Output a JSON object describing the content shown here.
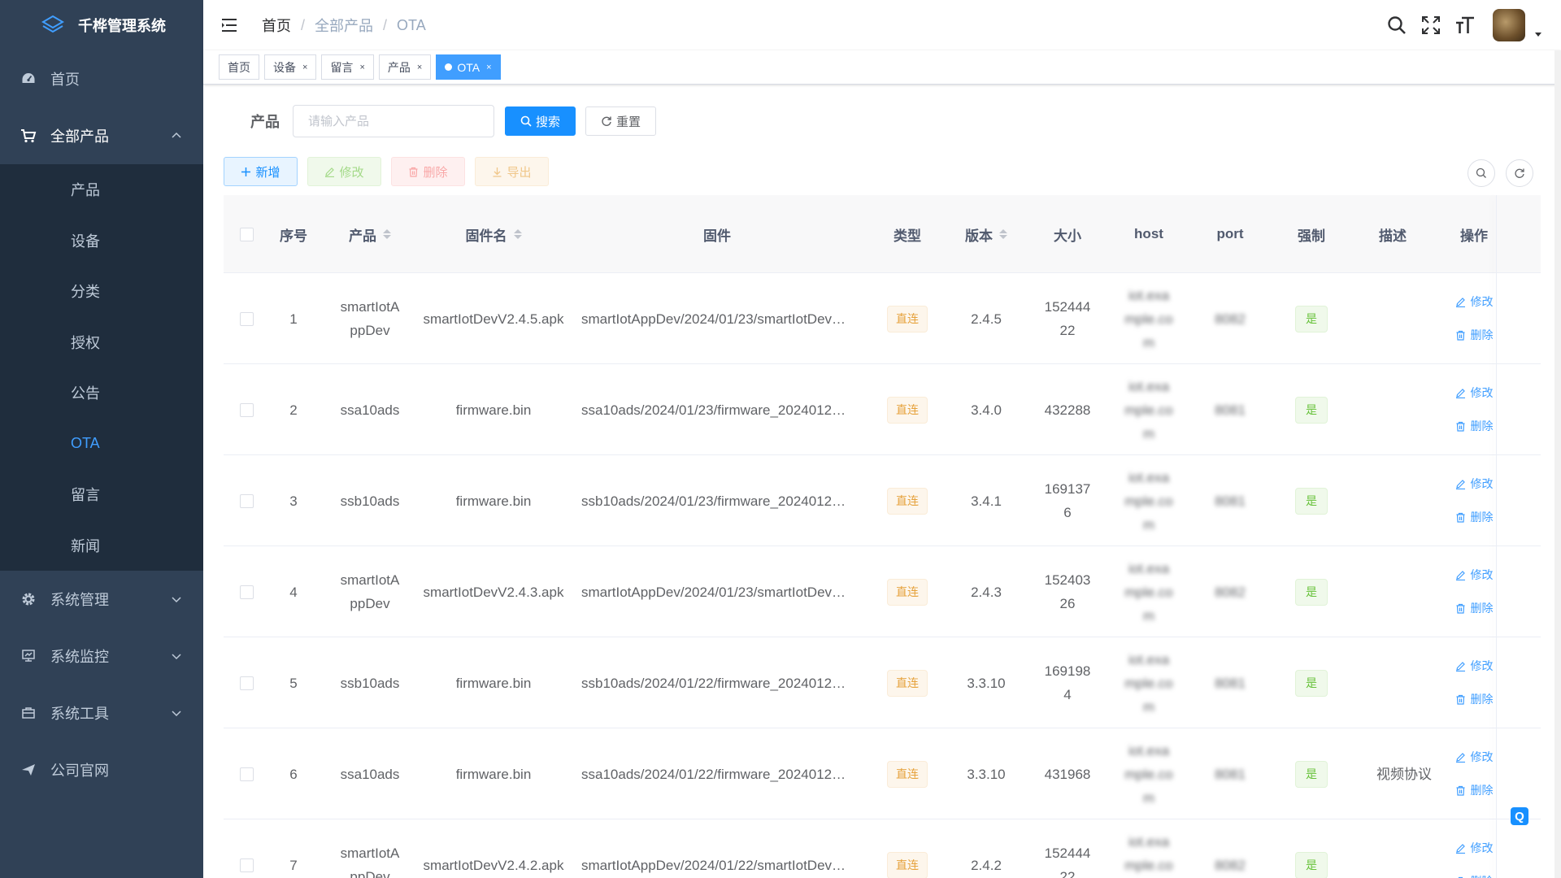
{
  "app": {
    "title": "千桦管理系统"
  },
  "sidebar": {
    "items": [
      {
        "label": "首页",
        "icon": "dashboard-icon"
      },
      {
        "label": "全部产品",
        "icon": "cart-icon",
        "open": true,
        "children": [
          {
            "label": "产品"
          },
          {
            "label": "设备"
          },
          {
            "label": "分类"
          },
          {
            "label": "授权"
          },
          {
            "label": "公告"
          },
          {
            "label": "OTA",
            "active": true
          },
          {
            "label": "留言"
          },
          {
            "label": "新闻"
          }
        ]
      },
      {
        "label": "系统管理",
        "icon": "gear-icon"
      },
      {
        "label": "系统监控",
        "icon": "monitor-icon"
      },
      {
        "label": "系统工具",
        "icon": "toolbox-icon"
      },
      {
        "label": "公司官网",
        "icon": "send-icon"
      }
    ]
  },
  "breadcrumb": [
    "首页",
    "全部产品",
    "OTA"
  ],
  "tags": [
    {
      "label": "首页"
    },
    {
      "label": "设备"
    },
    {
      "label": "留言"
    },
    {
      "label": "产品"
    },
    {
      "label": "OTA",
      "active": true
    }
  ],
  "search": {
    "label": "产品",
    "placeholder": "请输入产品",
    "search_btn": "搜索",
    "reset_btn": "重置"
  },
  "toolbar": {
    "add": "新增",
    "edit": "修改",
    "delete": "删除",
    "export": "导出"
  },
  "table": {
    "headers": {
      "index": "序号",
      "product": "产品",
      "firmware_name": "固件名",
      "firmware": "固件",
      "type": "类型",
      "version": "版本",
      "size": "大小",
      "host": "host",
      "port": "port",
      "force": "强制",
      "desc": "描述",
      "ops": "操作"
    },
    "op_edit": "修改",
    "op_delete": "删除",
    "rows": [
      {
        "index": "1",
        "product": "smartIotAppDev",
        "firmware_name": "smartIotDevV2.4.5.apk",
        "firmware": "smartIotAppDev/2024/01/23/smartIotDevV…",
        "type": "直连",
        "version": "2.4.5",
        "size": "15244422",
        "host": "iot.example.com",
        "port": "8082",
        "force": "是",
        "desc": ""
      },
      {
        "index": "2",
        "product": "ssa10ads",
        "firmware_name": "firmware.bin",
        "firmware": "ssa10ads/2024/01/23/firmware_20240123…",
        "type": "直连",
        "version": "3.4.0",
        "size": "432288",
        "host": "iot.example.com",
        "port": "8081",
        "force": "是",
        "desc": ""
      },
      {
        "index": "3",
        "product": "ssb10ads",
        "firmware_name": "firmware.bin",
        "firmware": "ssb10ads/2024/01/23/firmware_20240123…",
        "type": "直连",
        "version": "3.4.1",
        "size": "1691376",
        "host": "iot.example.com",
        "port": "8081",
        "force": "是",
        "desc": ""
      },
      {
        "index": "4",
        "product": "smartIotAppDev",
        "firmware_name": "smartIotDevV2.4.3.apk",
        "firmware": "smartIotAppDev/2024/01/23/smartIotDevV…",
        "type": "直连",
        "version": "2.4.3",
        "size": "15240326",
        "host": "iot.example.com",
        "port": "8082",
        "force": "是",
        "desc": ""
      },
      {
        "index": "5",
        "product": "ssb10ads",
        "firmware_name": "firmware.bin",
        "firmware": "ssb10ads/2024/01/22/firmware_20240122…",
        "type": "直连",
        "version": "3.3.10",
        "size": "1691984",
        "host": "iot.example.com",
        "port": "8081",
        "force": "是",
        "desc": ""
      },
      {
        "index": "6",
        "product": "ssa10ads",
        "firmware_name": "firmware.bin",
        "firmware": "ssa10ads/2024/01/22/firmware_20240122…",
        "type": "直连",
        "version": "3.3.10",
        "size": "431968",
        "host": "iot.example.com",
        "port": "8081",
        "force": "是",
        "desc": "视频协议"
      },
      {
        "index": "7",
        "product": "smartIotAppDev",
        "firmware_name": "smartIotDevV2.4.2.apk",
        "firmware": "smartIotAppDev/2024/01/22/smartIotDevV…",
        "type": "直连",
        "version": "2.4.2",
        "size": "15244422",
        "host": "iot.example.com",
        "port": "8082",
        "force": "是",
        "desc": ""
      }
    ]
  }
}
